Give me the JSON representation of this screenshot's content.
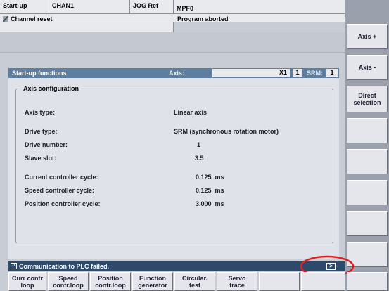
{
  "header": {
    "area": "Start-up",
    "channel": "CHAN1",
    "mode": "JOG Ref",
    "program": "MPF0",
    "channel_status": "Channel reset",
    "program_status": "Program aborted"
  },
  "right_softkeys": [
    "Axis +",
    "Axis -",
    "Direct selection",
    "",
    "",
    "",
    "",
    ""
  ],
  "panel": {
    "title": "Start-up functions",
    "axis_label": "Axis:",
    "axis_name": "X1",
    "axis_number": "1",
    "drive_label": "SRM:",
    "drive_number": "1",
    "group_title": "Axis configuration",
    "rows": [
      {
        "label": "Axis type:",
        "value": "Linear axis"
      },
      {
        "label": "Drive type:",
        "value": "SRM (synchronous rotation motor)"
      },
      {
        "label": "Drive number:",
        "value": "1"
      },
      {
        "label": "Slave slot:",
        "value": "3.5"
      },
      {
        "label": "Current controller cycle:",
        "value": "0.125  ms"
      },
      {
        "label": "Speed controller cycle:",
        "value": "0.125  ms"
      },
      {
        "label": "Position controller cycle:",
        "value": "3.000  ms"
      }
    ]
  },
  "message": "Communication to PLC failed.",
  "bottom_softkeys": [
    [
      "Curr contr",
      "loop"
    ],
    [
      "Speed",
      "contr.loop"
    ],
    [
      "Position",
      "contr.loop"
    ],
    [
      "Function",
      "generator"
    ],
    [
      "Circular.",
      "test"
    ],
    [
      "Servo",
      "trace"
    ]
  ],
  "colors": {
    "highlight_circle": "#e02020",
    "title_bar": "#5d7e9e",
    "message_bar": "#2e4a6a"
  }
}
